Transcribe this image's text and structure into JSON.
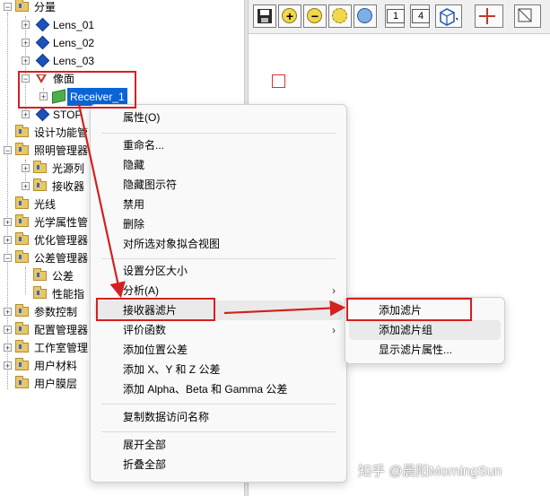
{
  "tree": {
    "items": [
      {
        "label": "分量",
        "icon": "folder-icon"
      },
      {
        "label": "Lens_01",
        "icon": "lens-diamond-icon"
      },
      {
        "label": "Lens_02",
        "icon": "lens-diamond-icon"
      },
      {
        "label": "Lens_03",
        "icon": "lens-diamond-icon"
      },
      {
        "label": "像面",
        "icon": "image-plane-icon"
      },
      {
        "label": "Receiver_1",
        "icon": "receiver-icon"
      },
      {
        "label": "STOP",
        "icon": "lens-diamond-icon"
      },
      {
        "label": "设计功能管",
        "icon": "folder-icon"
      },
      {
        "label": "照明管理器",
        "icon": "folder-icon"
      },
      {
        "label": "光源列",
        "icon": "folder-icon"
      },
      {
        "label": "接收器",
        "icon": "folder-icon"
      },
      {
        "label": "光线",
        "icon": "folder-icon"
      },
      {
        "label": "光学属性管",
        "icon": "folder-icon"
      },
      {
        "label": "优化管理器",
        "icon": "folder-icon"
      },
      {
        "label": "公差管理器",
        "icon": "folder-icon"
      },
      {
        "label": "公差",
        "icon": "folder-icon"
      },
      {
        "label": "性能指",
        "icon": "folder-icon"
      },
      {
        "label": "参数控制",
        "icon": "folder-icon"
      },
      {
        "label": "配置管理器",
        "icon": "folder-icon"
      },
      {
        "label": "工作室管理",
        "icon": "folder-icon"
      },
      {
        "label": "用户材料",
        "icon": "folder-icon"
      },
      {
        "label": "用户膜层",
        "icon": "folder-icon"
      }
    ]
  },
  "toolbar": {
    "box1_value": "1",
    "box4_value": "4"
  },
  "context_menu": {
    "items": [
      "属性(O)",
      "重命名...",
      "隐藏",
      "隐藏图示符",
      "禁用",
      "删除",
      "对所选对象拟合视图",
      "设置分区大小",
      "分析(A)",
      "接收器滤片",
      "评价函数",
      "添加位置公差",
      "添加 X、Y 和 Z 公差",
      "添加 Alpha、Beta 和 Gamma 公差",
      "复制数据访问名称",
      "展开全部",
      "折叠全部"
    ]
  },
  "submenu": {
    "items": [
      "添加滤片",
      "添加滤片组",
      "显示滤片属性..."
    ]
  },
  "watermark": "知乎 @晨阳MorningSun",
  "colors": {
    "annotation_red": "#d42020",
    "selection_blue": "#0a64d6",
    "folder_yellow": "#e8c766"
  }
}
